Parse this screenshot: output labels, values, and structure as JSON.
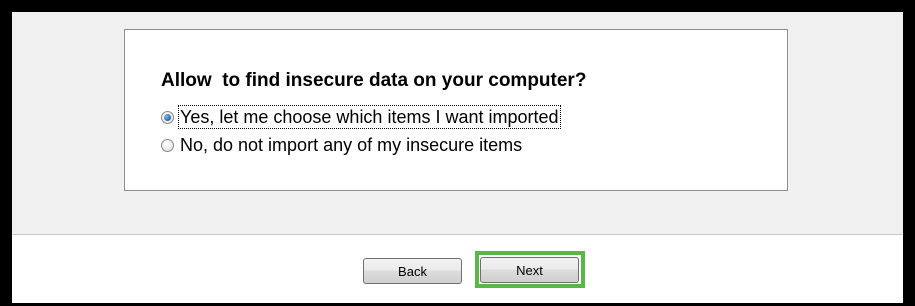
{
  "dialog": {
    "question": "Allow  to find insecure data on your computer?",
    "options": [
      {
        "label": "Yes, let me choose which items I want imported",
        "selected": true,
        "focused": true
      },
      {
        "label": "No, do not import any of my insecure items",
        "selected": false,
        "focused": false
      }
    ]
  },
  "footer": {
    "back_label": "Back",
    "next_label": "Next",
    "highlight_color": "#58b747"
  }
}
